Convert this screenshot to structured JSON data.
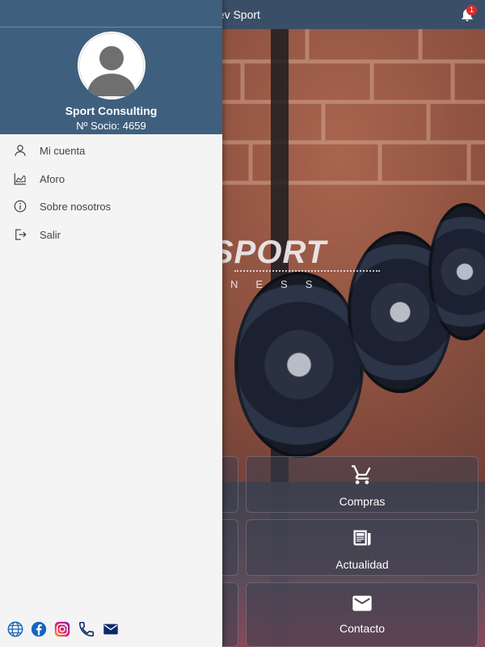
{
  "app": {
    "title": "Lev Sport",
    "notifications": {
      "count": "1"
    }
  },
  "brand": {
    "logo_text": "SPORT",
    "logo_sub": "NESS"
  },
  "tiles": [
    {
      "label": "Compras",
      "icon": "cart-icon"
    },
    {
      "label": "Actualidad",
      "icon": "newspaper-icon"
    },
    {
      "label": "Contacto",
      "icon": "envelope-icon"
    }
  ],
  "drawer": {
    "user_name": "Sport Consulting",
    "member_no": "Nº Socio: 4659",
    "menu": [
      {
        "label": "Mi cuenta",
        "icon": "user-icon"
      },
      {
        "label": "Aforo",
        "icon": "area-chart-icon"
      },
      {
        "label": "Sobre nosotros",
        "icon": "info-icon"
      },
      {
        "label": "Salir",
        "icon": "logout-icon"
      }
    ],
    "social": [
      "globe-icon",
      "facebook-icon",
      "instagram-icon",
      "phone-icon",
      "email-icon"
    ]
  },
  "colors": {
    "header": "#3a4f67",
    "drawer_header": "#3f5f7e",
    "drawer_bg": "#f4f4f4",
    "badge": "#d32f2f",
    "link_blue": "#1565c0",
    "navy": "#0d2b6b"
  }
}
